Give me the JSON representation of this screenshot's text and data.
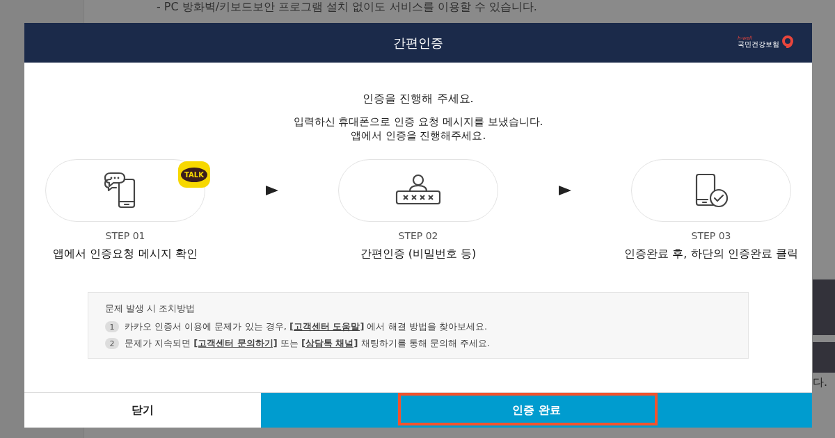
{
  "background": {
    "notice_line": "-  PC 방화벽/키보드보안 프로그램 설치 없이도 서비스를 이용할 수 있습니다.",
    "fragment": "다."
  },
  "dialog": {
    "title": "간편인증",
    "logo": {
      "tagline": "h-well",
      "name": "국민건강보험"
    },
    "heading": "인증을 진행해 주세요.",
    "messages": [
      "입력하신 휴대폰으로 인증 요청 메시지를 보냈습니다.",
      "앱에서 인증을 진행해주세요."
    ],
    "steps": [
      {
        "kind": "message",
        "badge": "TALK",
        "step": "STEP 01",
        "label": "앱에서 인증요청 메시지 확인"
      },
      {
        "kind": "password",
        "step": "STEP 02",
        "label": "간편인증 (비밀번호 등)"
      },
      {
        "kind": "done",
        "step": "STEP 03",
        "label": "인증완료 후, 하단의 인증완료 클릭"
      }
    ],
    "help": {
      "title": "문제 발생 시 조치방법",
      "items": [
        {
          "number": "1",
          "parts": [
            {
              "text": "카카오 인증서 이용에 문제가 있는 경우, ",
              "link": false
            },
            {
              "text": "[고객센터 도움말]",
              "link": true
            },
            {
              "text": " 에서 해결 방법을 찾아보세요.",
              "link": false
            }
          ]
        },
        {
          "number": "2",
          "parts": [
            {
              "text": "문제가 지속되면 ",
              "link": false
            },
            {
              "text": "[고객센터 문의하기]",
              "link": true
            },
            {
              "text": " 또는 ",
              "link": false
            },
            {
              "text": "[상담톡 채널]",
              "link": true
            },
            {
              "text": " 채팅하기를 통해 문의해 주세요.",
              "link": false
            }
          ]
        }
      ]
    },
    "buttons": [
      {
        "kind": "close",
        "label": "닫기",
        "highlighted": false
      },
      {
        "kind": "confirm",
        "label": "인증 완료",
        "highlighted": true
      }
    ]
  }
}
